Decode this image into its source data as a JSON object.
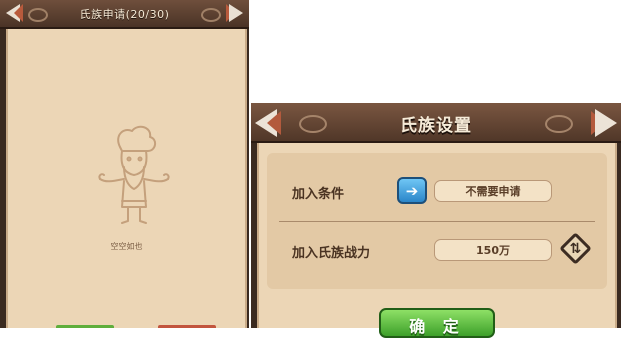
{
  "applications_panel": {
    "title": "氏族申请(20/30)",
    "empty_text": "空空如也"
  },
  "settings_dialog": {
    "title": "氏族设置",
    "join_condition": {
      "label": "加入条件",
      "value": "不需要申请",
      "arrow_icon": "arrow-left-icon"
    },
    "join_power": {
      "label": "加入氏族战力",
      "value": "150万",
      "edit_icon": "swap-diamond-icon"
    },
    "confirm_label": "确 定"
  },
  "colors": {
    "header_brown": "#5c3f2f",
    "panel_bg": "#ecd6b6",
    "arrow_blue": "#2b86c9",
    "confirm_green": "#3da02a",
    "accent_red": "#b35a3d"
  }
}
